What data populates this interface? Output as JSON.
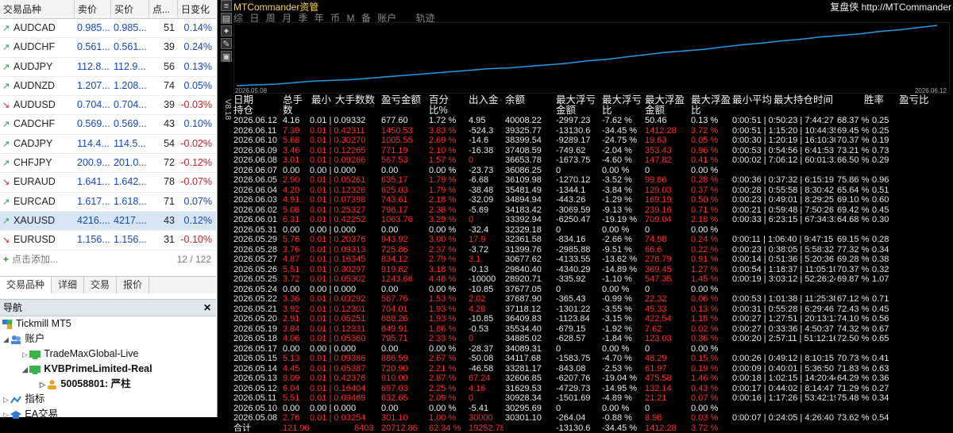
{
  "market_watch": {
    "headers": [
      "交易品种",
      "卖价",
      "买价",
      "点...",
      "日变化"
    ],
    "rows": [
      {
        "symbol": "AUDCAD",
        "dir": "up",
        "bid": "0.985...",
        "ask": "0.985...",
        "spread": "51",
        "change": "0.14%"
      },
      {
        "symbol": "AUDCHF",
        "dir": "up",
        "bid": "0.561...",
        "ask": "0.561...",
        "spread": "39",
        "change": "0.24%"
      },
      {
        "symbol": "AUDJPY",
        "dir": "up",
        "bid": "112.8...",
        "ask": "112.9...",
        "spread": "56",
        "change": "0.13%"
      },
      {
        "symbol": "AUDNZD",
        "dir": "up",
        "bid": "1.207...",
        "ask": "1.208...",
        "spread": "74",
        "change": "0.05%"
      },
      {
        "symbol": "AUDUSD",
        "dir": "dn",
        "bid": "0.704...",
        "ask": "0.704...",
        "spread": "39",
        "change": "-0.03%"
      },
      {
        "symbol": "CADCHF",
        "dir": "up",
        "bid": "0.569...",
        "ask": "0.569...",
        "spread": "43",
        "change": "0.10%"
      },
      {
        "symbol": "CADJPY",
        "dir": "up",
        "bid": "114.4...",
        "ask": "114.5...",
        "spread": "54",
        "change": "-0.02%"
      },
      {
        "symbol": "CHFJPY",
        "dir": "up",
        "bid": "200.9...",
        "ask": "201.0...",
        "spread": "72",
        "change": "-0.12%"
      },
      {
        "symbol": "EURAUD",
        "dir": "dn",
        "bid": "1.641...",
        "ask": "1.642...",
        "spread": "78",
        "change": "-0.07%"
      },
      {
        "symbol": "EURCAD",
        "dir": "up",
        "bid": "1.617...",
        "ask": "1.618...",
        "spread": "71",
        "change": "0.07%"
      },
      {
        "symbol": "XAUUSD",
        "dir": "up",
        "bid": "4216....",
        "ask": "4217....",
        "spread": "43",
        "change": "0.12%"
      },
      {
        "symbol": "EURUSD",
        "dir": "dn",
        "bid": "1.156...",
        "ask": "1.156...",
        "spread": "31",
        "change": "-0.10%"
      }
    ],
    "add_label": "点击添加...",
    "count": "12 / 122",
    "tabs": [
      "交易品种",
      "详细",
      "交易",
      "报价"
    ]
  },
  "navigator": {
    "title": "导航",
    "close": "✕",
    "root": "Tickmill MT5",
    "accounts": "账户",
    "acct1": "TradeMaxGlobal-Live",
    "acct2": "KVBPrimeLimited-Real",
    "acct2_user": "50058801: 严柱",
    "indicators": "指标",
    "ea": "EA交易"
  },
  "app": {
    "title": "MTCommander资管",
    "link": "复盘侠 http://MTCommander",
    "toolbar": [
      "≡",
      "▤",
      "✦",
      "✎",
      "▣"
    ],
    "version": "V8.18",
    "tabs": [
      "综",
      "日",
      "周",
      "月",
      "季",
      "年",
      "币",
      "M",
      "备",
      "账户"
    ],
    "tab_extra": "轨迹"
  },
  "chart_data": {
    "type": "line",
    "x_start": "2026.05.08",
    "x_end": "2026.06.12",
    "y_values": [
      8,
      9,
      10,
      12,
      14,
      15,
      16,
      18,
      20,
      22,
      24,
      26,
      28,
      30,
      31,
      33,
      35,
      37,
      40,
      42,
      45,
      48,
      51,
      53,
      55,
      58,
      61,
      63,
      66,
      68,
      71,
      73,
      75,
      78,
      80,
      83,
      86
    ]
  },
  "table": {
    "headers_line1": "日期     总手数 最小 大手数数   盈亏金额        百分比% 出入金    余额               最大浮亏 亏金额 最大浮亏比    最大浮盈 金额 最大浮盈比 最小平均 最大持仓时间            胜率          盈亏比",
    "header_cols": [
      "日期",
      "总手数",
      "最小",
      "大手数数",
      "盈亏金额",
      "百分比%",
      "出入金",
      "余额",
      "最大浮亏金额",
      "最大浮亏比",
      "最大浮盈金额",
      "最大浮盈比",
      "最小平均",
      "最大持仓时间",
      "胜率",
      "盈亏比"
    ],
    "header_line2": "持仓",
    "rows": [
      {
        "c": "w",
        "d": "2026.06.12",
        "n": "4.16",
        "mn": "0.01",
        "mx": "0.09",
        "k": "332",
        "pl": "677.60",
        "pct": "1.72 %",
        "io": "4.95",
        "bal": "40008.22",
        "fl": "-2997.23",
        "flp": "-7.62 %",
        "fp": "50.46",
        "fpp": "0.13 %",
        "tm": "0:00:51 | 0:50:23 | 7:44:27",
        "wr": "68.37 %",
        "pr": "0.25"
      },
      {
        "c": "r",
        "d": "2026.06.11",
        "n": "7.39",
        "mn": "0.01",
        "mx": "0.42",
        "k": "311",
        "pl": "1450.53",
        "pct": "3.83 %",
        "io": "-524.3",
        "bal": "39325.77",
        "fl": "-13130.6",
        "flp": "-34.45 %",
        "fp": "1412.28",
        "fpp": "3.72 %",
        "tm": "0:00:51 | 1:15:20 | 10:44:35",
        "wr": "69.45 %",
        "pr": "0.25"
      },
      {
        "c": "r",
        "d": "2026.06.10",
        "n": "5.68",
        "mn": "0.01",
        "mx": "0.30",
        "k": "270",
        "pl": "1005.55",
        "pct": "2.69 %",
        "io": "-14.6",
        "bal": "38399.54",
        "fl": "-9289.17",
        "flp": "-24.75 %",
        "fp": "19.63",
        "fpp": "0.05 %",
        "tm": "0:00:30 | 1:20:19 | 16:10:30",
        "wr": "70.37 %",
        "pr": "0.19"
      },
      {
        "c": "r",
        "d": "2026.06.09",
        "n": "3.46",
        "mn": "0.01",
        "mx": "0.12",
        "k": "265",
        "pl": "771.19",
        "pct": "2.10 %",
        "io": "-16.38",
        "bal": "37408.59",
        "fl": "-749.62",
        "flp": "-2.04 %",
        "fp": "353.43",
        "fpp": "0.96 %",
        "tm": "0:00:53 | 0:54:56 | 6:41:53",
        "wr": "73.21 %",
        "pr": "0.73"
      },
      {
        "c": "r",
        "d": "2026.06.08",
        "n": "3.01",
        "mn": "0.01",
        "mx": "0.09",
        "k": "266",
        "pl": "567.53",
        "pct": "1.57 %",
        "io": "0",
        "bal": "36653.78",
        "fl": "-1673.75",
        "flp": "-4.60 %",
        "fp": "147.82",
        "fpp": "0.41 %",
        "tm": "0:00:02 | 7:06:12 | 60:01:31",
        "wr": "66.50 %",
        "pr": "0.29"
      },
      {
        "c": "w",
        "d": "2026.06.07",
        "n": "0.00",
        "mn": "0.00",
        "mx": "0.00",
        "k": "0",
        "pl": "0.00",
        "pct": "0.00 %",
        "io": "-23.73",
        "bal": "36086.25",
        "fl": "0",
        "flp": "0.00 %",
        "fp": "0",
        "fpp": "0.00 %",
        "tm": "",
        "wr": "",
        "pr": ""
      },
      {
        "c": "r",
        "d": "2026.06.05",
        "n": "2.90",
        "mn": "0.01",
        "mx": "0.05",
        "k": "261",
        "pl": "635.17",
        "pct": "1.79 %",
        "io": "-6.68",
        "bal": "36109.98",
        "fl": "-1270.12",
        "flp": "-3.52 %",
        "fp": "99.86",
        "fpp": "0.28 %",
        "tm": "0:00:36 | 0:37:32 | 6:15:19",
        "wr": "75.86 %",
        "pr": "0.96"
      },
      {
        "c": "r",
        "d": "2026.06.04",
        "n": "4.20",
        "mn": "0.01",
        "mx": "0.12",
        "k": "326",
        "pl": "625.03",
        "pct": "1.79 %",
        "io": "-38.48",
        "bal": "35481.49",
        "fl": "-1344.1",
        "flp": "-3.84 %",
        "fp": "129.03",
        "fpp": "0.37 %",
        "tm": "0:00:28 | 0:55:58 | 8:30:42",
        "wr": "65.64 %",
        "pr": "0.51"
      },
      {
        "c": "r",
        "d": "2026.06.03",
        "n": "4.91",
        "mn": "0.01",
        "mx": "0.07",
        "k": "398",
        "pl": "743.61",
        "pct": "2.18 %",
        "io": "-32.09",
        "bal": "34894.94",
        "fl": "-443.26",
        "flp": "-1.29 %",
        "fp": "169.19",
        "fpp": "0.50 %",
        "tm": "0:00:23 | 0:49:01 | 8:29:25",
        "wr": "69.10 %",
        "pr": "0.60"
      },
      {
        "c": "r",
        "d": "2026.06.02",
        "n": "5.08",
        "mn": "0.01",
        "mx": "0.25",
        "k": "327",
        "pl": "796.17",
        "pct": "2.38 %",
        "io": "-5.69",
        "bal": "34183.42",
        "fl": "-3069.59",
        "flp": "-9.13 %",
        "fp": "239.16",
        "fpp": "0.71 %",
        "tm": "0:00:21 | 0:59:48 | 7:50:26",
        "wr": "69.42 %",
        "pr": "0.45"
      },
      {
        "c": "r",
        "d": "2026.06.01",
        "n": "6.31",
        "mn": "0.01",
        "mx": "0.42",
        "k": "252",
        "pl": "1063.76",
        "pct": "3.29 %",
        "io": "0",
        "bal": "33392.94",
        "fl": "-6250.47",
        "flp": "-19.19 %",
        "fp": "709.04",
        "fpp": "2.18 %",
        "tm": "0:00:33 | 6:23:15 | 67:34:31",
        "wr": "64.68 %",
        "pr": "0.30"
      },
      {
        "c": "w",
        "d": "2026.05.31",
        "n": "0.00",
        "mn": "0.00",
        "mx": "0.00",
        "k": "0",
        "pl": "0.00",
        "pct": "0.00 %",
        "io": "-32.4",
        "bal": "32329.18",
        "fl": "0",
        "flp": "0.00 %",
        "fp": "0",
        "fpp": "0.00 %",
        "tm": "",
        "wr": "",
        "pr": ""
      },
      {
        "c": "r",
        "d": "2026.05.29",
        "n": "5.76",
        "mn": "0.01",
        "mx": "0.20",
        "k": "376",
        "pl": "943.92",
        "pct": "3.00 %",
        "io": "17.9",
        "bal": "32361.58",
        "fl": "-834.16",
        "flp": "-2.66 %",
        "fp": "74.98",
        "fpp": "0.24 %",
        "tm": "0:00:11 | 1:06:40 | 9:47:15",
        "wr": "69.15 %",
        "pr": "0.28"
      },
      {
        "c": "r",
        "d": "2026.05.28",
        "n": "3.76",
        "mn": "0.01",
        "mx": "0.09",
        "k": "313",
        "pl": "725.86",
        "pct": "2.37 %",
        "io": "-3.72",
        "bal": "31399.76",
        "fl": "-2985.88",
        "flp": "-9.51 %",
        "fp": "66.6",
        "fpp": "0.22 %",
        "tm": "0:00:23 | 0:38:05 | 5:58:32",
        "wr": "77.32 %",
        "pr": "0.34"
      },
      {
        "c": "r",
        "d": "2026.05.27",
        "n": "4.87",
        "mn": "0.01",
        "mx": "0.16",
        "k": "345",
        "pl": "834.12",
        "pct": "2.79 %",
        "io": "3.1",
        "bal": "30677.62",
        "fl": "-4133.55",
        "flp": "-13.62 %",
        "fp": "276.79",
        "fpp": "0.91 %",
        "tm": "0:00:14 | 0:51:36 | 5:20:36",
        "wr": "69.28 %",
        "pr": "0.38"
      },
      {
        "c": "r",
        "d": "2026.05.26",
        "n": "5.51",
        "mn": "0.01",
        "mx": "0.30",
        "k": "297",
        "pl": "919.82",
        "pct": "3.18 %",
        "io": "-0.13",
        "bal": "29840.40",
        "fl": "-4340.29",
        "flp": "-14.89 %",
        "fp": "369.45",
        "fpp": "1.27 %",
        "tm": "0:00:54 | 1:18:37 | 11:05:10",
        "wr": "70.37 %",
        "pr": "0.32"
      },
      {
        "c": "r",
        "d": "2026.05.25",
        "n": "3.72",
        "mn": "0.01",
        "mx": "0.05",
        "k": "302",
        "pl": "1243.66",
        "pct": "4.48 %",
        "io": "-10000",
        "bal": "28920.71",
        "fl": "-335.92",
        "flp": "-1.10 %",
        "fp": "547.35",
        "fpp": "1.45 %",
        "tm": "0:00:19 | 3:03:12 | 52:26:24",
        "wr": "69.87 %",
        "pr": "1.07"
      },
      {
        "c": "w",
        "d": "2026.05.24",
        "n": "0.00",
        "mn": "0.00",
        "mx": "0.00",
        "k": "0",
        "pl": "0.00",
        "pct": "0.00 %",
        "io": "-10.85",
        "bal": "37677.05",
        "fl": "0",
        "flp": "0.00 %",
        "fp": "0",
        "fpp": "0.00 %",
        "tm": "",
        "wr": "",
        "pr": ""
      },
      {
        "c": "r",
        "d": "2026.05.22",
        "n": "3.36",
        "mn": "0.01",
        "mx": "0.03",
        "k": "292",
        "pl": "567.76",
        "pct": "1.53 %",
        "io": "2.02",
        "bal": "37687.90",
        "fl": "-365.43",
        "flp": "-0.99 %",
        "fp": "22.32",
        "fpp": "0.06 %",
        "tm": "0:00:53 | 1:01:38 | 11:25:38",
        "wr": "67.12 %",
        "pr": "0.71"
      },
      {
        "c": "r",
        "d": "2026.05.21",
        "n": "3.92",
        "mn": "0.01",
        "mx": "0.12",
        "k": "301",
        "pl": "704.01",
        "pct": "1.93 %",
        "io": "4.28",
        "bal": "37118.12",
        "fl": "-1301.22",
        "flp": "-3.55 %",
        "fp": "45.33",
        "fpp": "0.13 %",
        "tm": "0:00:31 | 0:55:28 | 6:29:46",
        "wr": "72.43 %",
        "pr": "0.45"
      },
      {
        "c": "r",
        "d": "2026.05.20",
        "n": "2.91",
        "mn": "0.01",
        "mx": "0.05",
        "k": "251",
        "pl": "688.26",
        "pct": "1.93 %",
        "io": "-10.85",
        "bal": "36409.83",
        "fl": "-1123.84",
        "flp": "-3.15 %",
        "fp": "422.54",
        "fpp": "1.18 %",
        "tm": "0:00:27 | 1:27:51 | 20:13:13",
        "wr": "74.10 %",
        "pr": "0.56"
      },
      {
        "c": "r",
        "d": "2026.05.19",
        "n": "3.84",
        "mn": "0.01",
        "mx": "0.12",
        "k": "331",
        "pl": "649.91",
        "pct": "1.86 %",
        "io": "-0.53",
        "bal": "35534.40",
        "fl": "-679.15",
        "flp": "-1.92 %",
        "fp": "7.62",
        "fpp": "0.02 %",
        "tm": "0:00:27 | 0:33:36 | 4:50:37",
        "wr": "74.32 %",
        "pr": "0.67"
      },
      {
        "c": "r",
        "d": "2026.05.18",
        "n": "4.06",
        "mn": "0.01",
        "mx": "0.05",
        "k": "360",
        "pl": "795.71",
        "pct": "2.33 %",
        "io": "0",
        "bal": "34885.02",
        "fl": "-628.57",
        "flp": "-1.84 %",
        "fp": "123.03",
        "fpp": "0.36 %",
        "tm": "0:00:20 | 2:57:11 | 51:12:16",
        "wr": "72.50 %",
        "pr": "0.65"
      },
      {
        "c": "w",
        "d": "2026.05.17",
        "n": "0.00",
        "mn": "0.00",
        "mx": "0.00",
        "k": "0",
        "pl": "0.00",
        "pct": "0.00 %",
        "io": "-28.37",
        "bal": "34089.31",
        "fl": "0",
        "flp": "0.00 %",
        "fp": "0",
        "fpp": "0.00 %",
        "tm": "",
        "wr": "",
        "pr": ""
      },
      {
        "c": "r",
        "d": "2026.05.15",
        "n": "5.13",
        "mn": "0.01",
        "mx": "0.09",
        "k": "386",
        "pl": "886.59",
        "pct": "2.67 %",
        "io": "-50.08",
        "bal": "34117.68",
        "fl": "-1583.75",
        "flp": "-4.70 %",
        "fp": "48.29",
        "fpp": "0.15 %",
        "tm": "0:00:26 | 0:49:12 | 8:10:15",
        "wr": "70.73 %",
        "pr": "0.41"
      },
      {
        "c": "r",
        "d": "2026.05.14",
        "n": "4.45",
        "mn": "0.01",
        "mx": "0.05",
        "k": "387",
        "pl": "720.90",
        "pct": "2.21 %",
        "io": "-46.58",
        "bal": "33281.17",
        "fl": "-843.08",
        "flp": "-2.53 %",
        "fp": "61.97",
        "fpp": "0.19 %",
        "tm": "0:00:09 | 0:40:01 | 5:36:50",
        "wr": "71.83 %",
        "pr": "0.63"
      },
      {
        "c": "r",
        "d": "2026.05.13",
        "n": "9.09",
        "mn": "0.01",
        "mx": "0.42",
        "k": "376",
        "pl": "910.00",
        "pct": "2.87 %",
        "io": "67.24",
        "bal": "32606.85",
        "fl": "-6207.76",
        "flp": "-19.04 %",
        "fp": "475.58",
        "fpp": "1.46 %",
        "tm": "0:00:18 | 1:02:15 | 14:20:44",
        "wr": "64.29 %",
        "pr": "0.36"
      },
      {
        "c": "r",
        "d": "2026.05.12",
        "n": "6.04",
        "mn": "0.01",
        "mx": "0.16",
        "k": "404",
        "pl": "697.03",
        "pct": "2.25 %",
        "io": "4.16",
        "bal": "31629.53",
        "fl": "-4729.73",
        "flp": "-14.95 %",
        "fp": "132.14",
        "fpp": "0.43 %",
        "tm": "0:00:17 | 0:44:02 | 8:14:47",
        "wr": "71.29 %",
        "pr": "0.27"
      },
      {
        "c": "r",
        "d": "2026.05.11",
        "n": "5.51",
        "mn": "0.01",
        "mx": "0.09",
        "k": "469",
        "pl": "632.65",
        "pct": "2.09 %",
        "io": "0",
        "bal": "30928.34",
        "fl": "-1501.69",
        "flp": "-4.89 %",
        "fp": "21.21",
        "fpp": "0.07 %",
        "tm": "0:00:16 | 1:17:26 | 53:42:19",
        "wr": "75.48 %",
        "pr": "0.34"
      },
      {
        "c": "w",
        "d": "2026.05.10",
        "n": "0.00",
        "mn": "0.00",
        "mx": "0.00",
        "k": "0",
        "pl": "0.00",
        "pct": "0.00 %",
        "io": "-5.41",
        "bal": "30295.69",
        "fl": "0",
        "flp": "0.00 %",
        "fp": "0",
        "fpp": "0.00 %",
        "tm": "",
        "wr": "",
        "pr": ""
      },
      {
        "c": "r",
        "d": "2026.05.08",
        "n": "2.76",
        "mn": "0.01",
        "mx": "0.03",
        "k": "254",
        "pl": "301.10",
        "pct": "1.00 %",
        "io": "30000",
        "bal": "30301.10",
        "fl": "-264.04",
        "flp": "-0.88 %",
        "fp": "8.98",
        "fpp": "0.03 %",
        "tm": "0:00:07 | 0:24:05 | 4:26:40",
        "wr": "73.62 %",
        "pr": "0.54"
      }
    ],
    "total": {
      "d": "合计",
      "n": "121.96",
      "k": "8403",
      "pl": "20712.86",
      "pct": "62.34 %",
      "io": "19252.78",
      "fl": "-13130.6",
      "flp": "-34.45 %",
      "fp": "1412.28",
      "fpp": "3.72 %"
    }
  }
}
